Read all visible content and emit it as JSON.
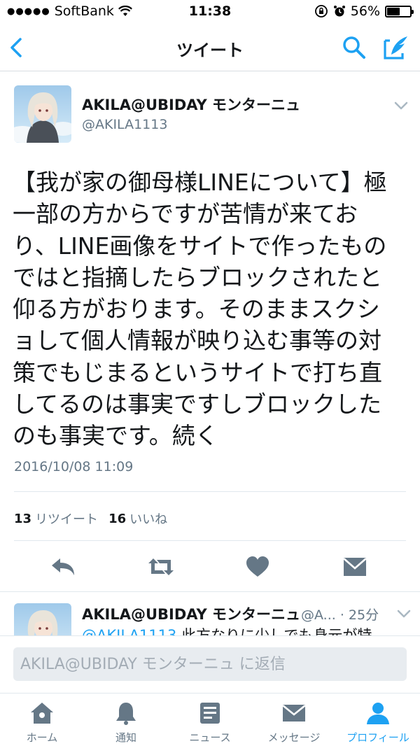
{
  "status_bar": {
    "carrier": "SoftBank",
    "time": "11:38",
    "battery_text": "56%",
    "battery_level": 0.56
  },
  "nav": {
    "title": "ツイート"
  },
  "tweet": {
    "user_name": "AKILA@UBIDAY モンターニュ",
    "handle": "@AKILA1113",
    "text": "【我が家の御母様LINEについて】極\n一部の方からですが苦情が来てお\nり、LINE画像をサイトで作ったもの\nではと指摘したらブロックされたと\n仰る方がおります。そのままスクシ\nョして個人情報が映り込む事等の対\n策でもじまるというサイトで打ち直\nしてるのは事実ですしブロックした\nのも事実です。続く",
    "date": "2016/10/08 11:09",
    "retweet_count": "13",
    "retweet_label": "リツイート",
    "like_count": "16",
    "like_label": "いいね"
  },
  "reply_preview": {
    "user_name": "AKILA@UBIDAY モンターニュ",
    "meta": "@A... · 25分",
    "mention": "@AKILA1113",
    "text": "此方なりに少しでも身元が特"
  },
  "reply_input": {
    "placeholder": "AKILA@UBIDAY モンターニュ に返信"
  },
  "tabs": [
    {
      "label": "ホーム",
      "icon": "home-icon"
    },
    {
      "label": "通知",
      "icon": "bell-icon"
    },
    {
      "label": "ニュース",
      "icon": "news-icon"
    },
    {
      "label": "メッセージ",
      "icon": "mail-icon"
    },
    {
      "label": "プロフィール",
      "icon": "profile-icon",
      "active": true
    }
  ],
  "colors": {
    "accent": "#1da1f2",
    "secondary_text": "#657786",
    "icon_gray": "#657786",
    "divider": "#e1e8ed"
  }
}
